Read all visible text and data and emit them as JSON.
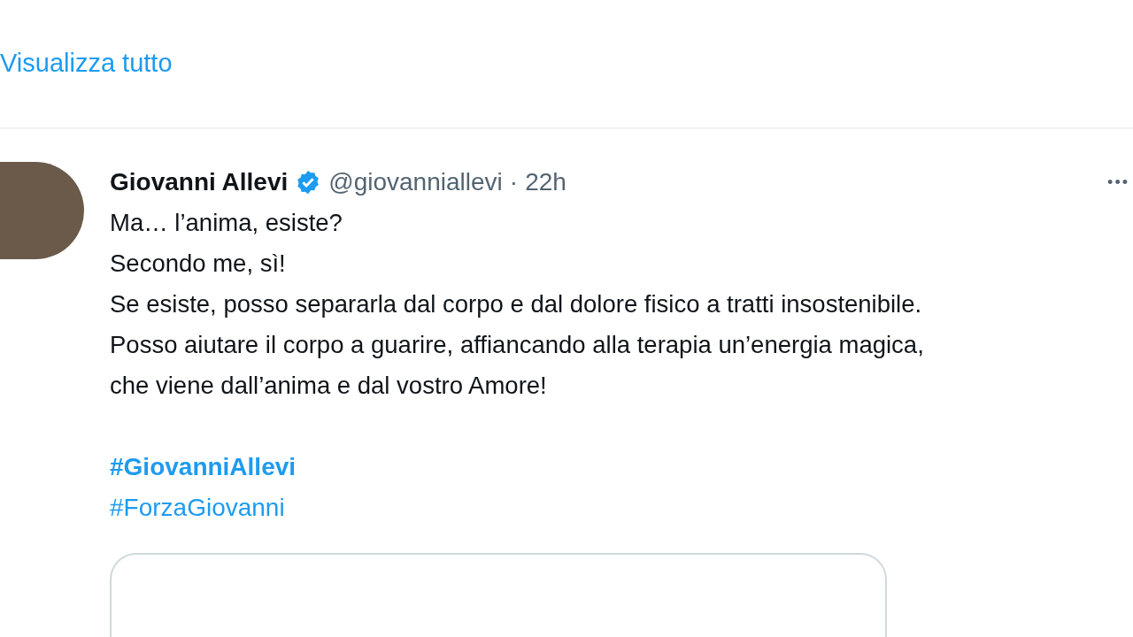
{
  "show_all_link": "Visualizza tutto",
  "tweet": {
    "author_name": "Giovanni Allevi",
    "verified": true,
    "handle": "@giovanniallevi",
    "separator": "·",
    "time": "22h",
    "more_menu": "•••",
    "lines": [
      "Ma… l’anima, esiste?",
      "Secondo me, sì!",
      "Se esiste, posso separarla dal corpo e dal dolore fisico a tratti insostenibile.",
      "Posso aiutare il corpo a guarire, affiancando alla terapia un’energia magica,",
      "che viene dall’anima e dal vostro Amore!"
    ],
    "hashtags": [
      {
        "text": "#GiovanniAllevi",
        "bold": true
      },
      {
        "text": "#ForzaGiovanni",
        "bold": false
      }
    ]
  }
}
